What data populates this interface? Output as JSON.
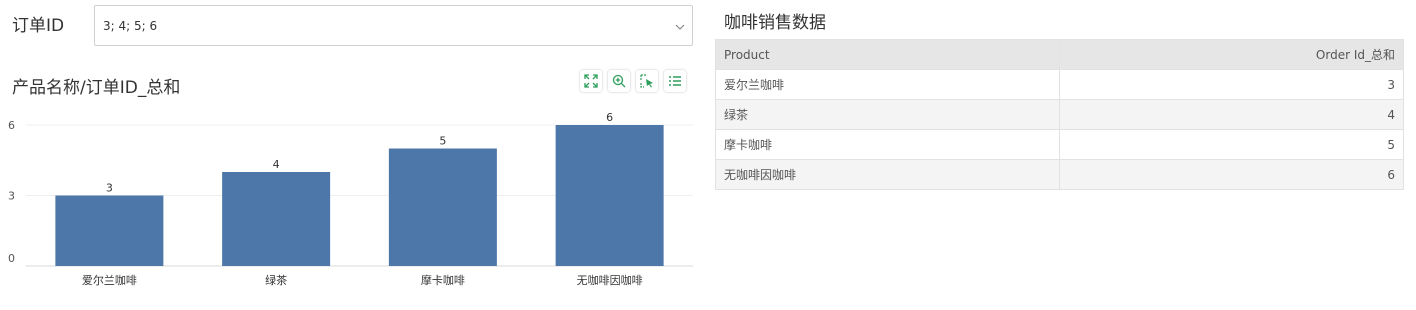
{
  "filter": {
    "label": "订单ID",
    "value": "3; 4; 5; 6"
  },
  "chart": {
    "title": "产品名称/订单ID_总和",
    "toolbar": [
      "expand-icon",
      "zoom-in-icon",
      "select-icon",
      "list-icon"
    ],
    "bar_color": "#4d77a8"
  },
  "chart_data": {
    "type": "bar",
    "title": "产品名称/订单ID_总和",
    "categories": [
      "爱尔兰咖啡",
      "绿茶",
      "摩卡咖啡",
      "无咖啡因咖啡"
    ],
    "values": [
      3,
      4,
      5,
      6
    ],
    "data_labels": [
      "3",
      "4",
      "5",
      "6"
    ],
    "yticks": [
      "0",
      "3",
      "6"
    ],
    "ylim": [
      0,
      6
    ],
    "xlabel": "",
    "ylabel": "",
    "grid": true
  },
  "table": {
    "title": "咖啡销售数据",
    "columns": [
      "Product",
      "Order Id_总和"
    ],
    "rows": [
      [
        "爱尔兰咖啡",
        "3"
      ],
      [
        "绿茶",
        "4"
      ],
      [
        "摩卡咖啡",
        "5"
      ],
      [
        "无咖啡因咖啡",
        "6"
      ]
    ]
  }
}
